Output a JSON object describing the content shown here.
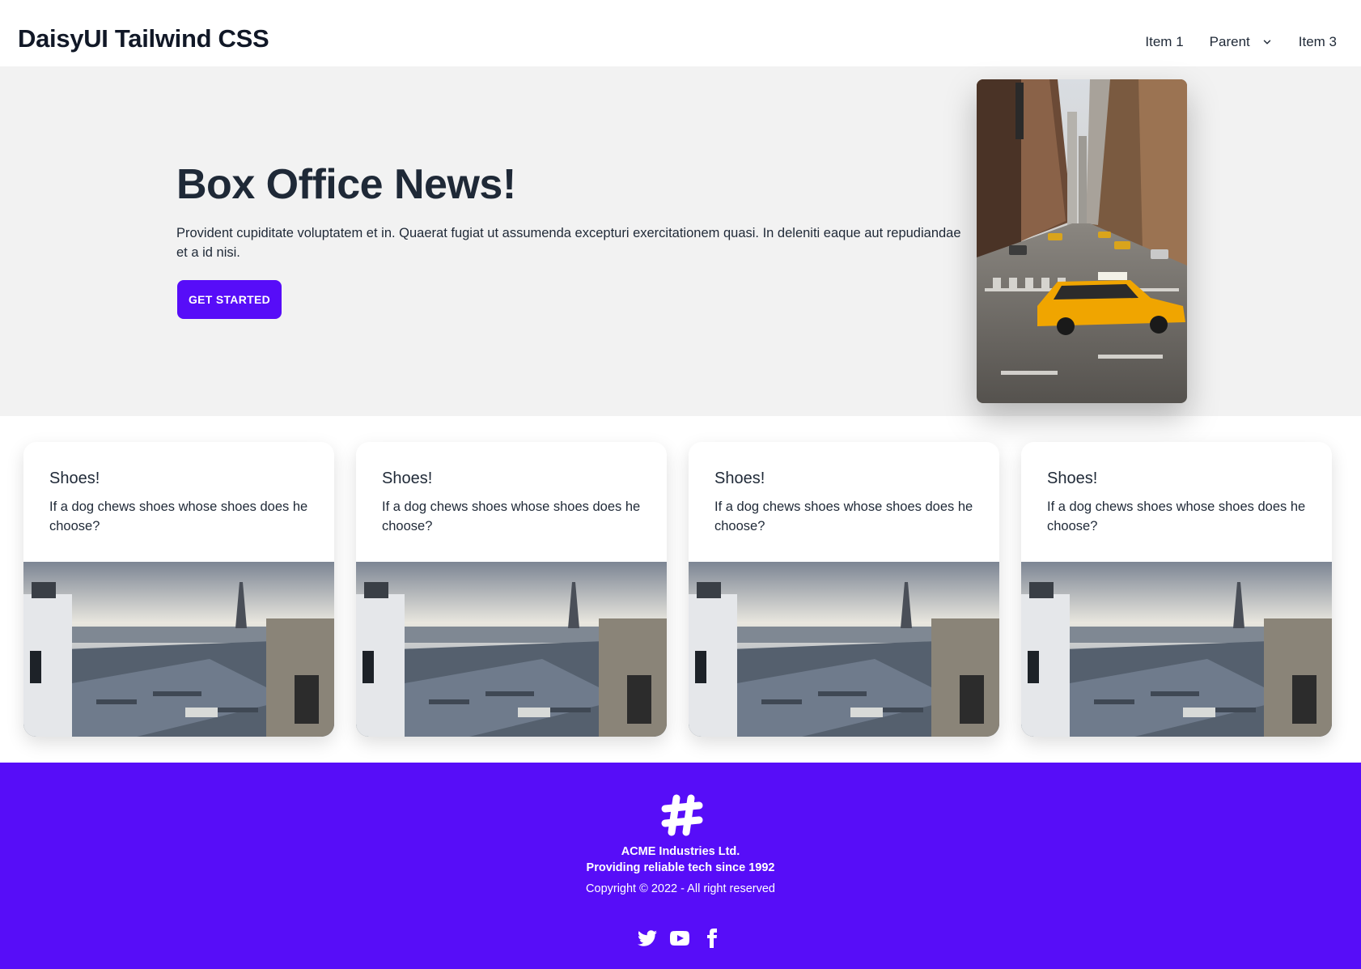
{
  "navbar": {
    "brand": "DaisyUI Tailwind CSS",
    "items": [
      {
        "label": "Item 1"
      },
      {
        "label": "Parent"
      },
      {
        "label": "Item 3"
      }
    ]
  },
  "hero": {
    "title": "Box Office News!",
    "text": "Provident cupiditate voluptatem et in. Quaerat fugiat ut assumenda excepturi exercitationem quasi. In deleniti eaque aut repudiandae et a id nisi.",
    "button_label": "GET STARTED",
    "image_icon": "city-street-taxi-photo"
  },
  "cards": [
    {
      "title": "Shoes!",
      "text": "If a dog chews shoes whose shoes does he choose?",
      "image_icon": "paris-rooftops-photo"
    },
    {
      "title": "Shoes!",
      "text": "If a dog chews shoes whose shoes does he choose?",
      "image_icon": "paris-rooftops-photo"
    },
    {
      "title": "Shoes!",
      "text": "If a dog chews shoes whose shoes does he choose?",
      "image_icon": "paris-rooftops-photo"
    },
    {
      "title": "Shoes!",
      "text": "If a dog chews shoes whose shoes does he choose?",
      "image_icon": "paris-rooftops-photo"
    }
  ],
  "footer": {
    "company": "ACME Industries Ltd.",
    "tagline": "Providing reliable tech since 1992",
    "copyright": "Copyright © 2022 - All right reserved",
    "social": [
      "twitter-icon",
      "youtube-icon",
      "facebook-icon"
    ]
  },
  "colors": {
    "primary": "#570df8",
    "hero_bg": "#f2f2f2",
    "text": "#1f2937"
  }
}
